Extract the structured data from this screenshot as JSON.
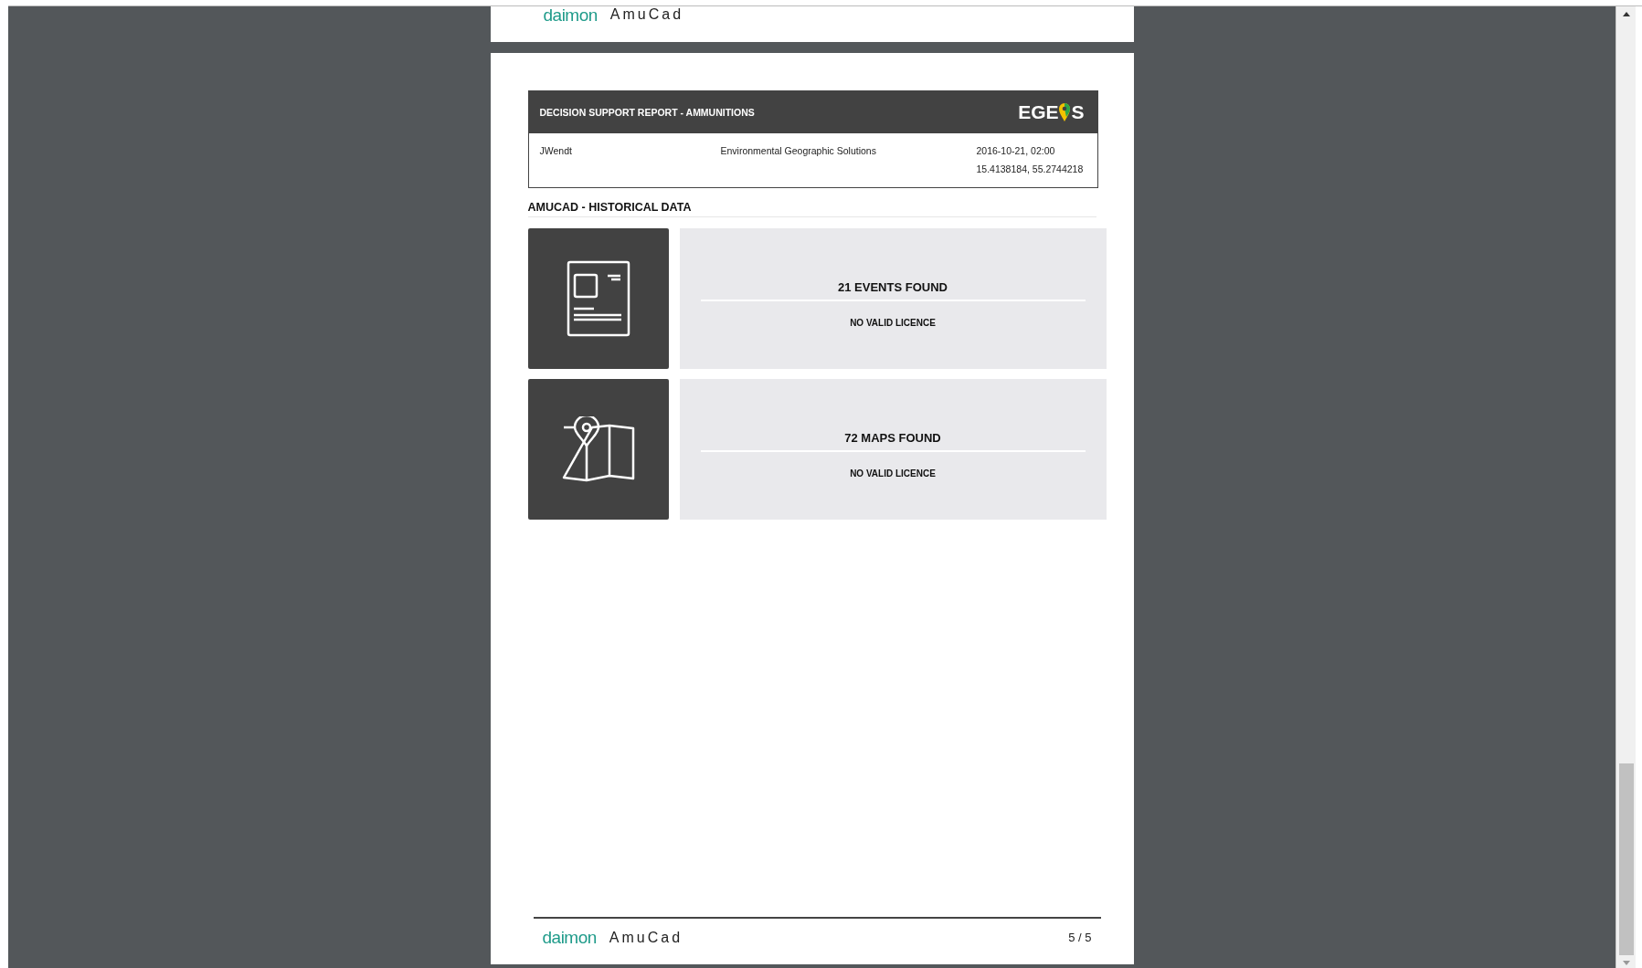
{
  "previous_page": {
    "footer": {
      "logo": "daimon",
      "app_name": "AmuCad"
    }
  },
  "page": {
    "header": {
      "title": "DECISION SUPPORT REPORT - AMMUNITIONS",
      "logo": {
        "before": "EGE",
        "after": "S"
      },
      "user": "JWendt",
      "organisation": "Environmental Geographic Solutions",
      "date": "2016-10-21, 02:00",
      "coordinates": "15.4138184, 55.2744218"
    },
    "section_title": "AMUCAD - HISTORICAL DATA",
    "results": [
      {
        "kind": "events",
        "count": "21 EVENTS FOUND",
        "status": "NO VALID LICENCE"
      },
      {
        "kind": "maps",
        "count": "72 MAPS FOUND",
        "status": "NO VALID LICENCE"
      }
    ],
    "footer": {
      "logo": "daimon",
      "app_name": "AmuCad",
      "page_number": "5 / 5"
    }
  }
}
